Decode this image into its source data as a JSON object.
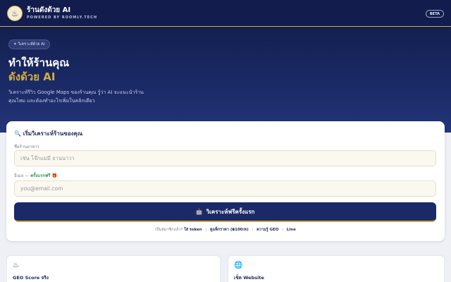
{
  "header": {
    "logo_icon": "chef-pot-icon",
    "title": "ร้านดังด้วย AI",
    "subtitle": "POWERED BY ROOMLY.TECH",
    "badge": "BETA"
  },
  "hero": {
    "badge": "✦ วิเคราะห์ด้วย AI",
    "headline_1": "ทำให้ร้านคุณ",
    "headline_2": "ดังด้วย AI",
    "description": "วิเคราะห์รีวิว Google Maps ของร้านคุณ รู้ว่า AI จะแนะนำร้านคุณไหม และต้องทำอะไรเพิ่มในคลิกเดียว"
  },
  "form": {
    "title": "🔍 เริ่มวิเคราะห์ร้านของคุณ",
    "restaurant_label": "ชื่อร้านอาหาร",
    "restaurant_placeholder": "เช่น โจ๊กแม่มี ยานนาวา",
    "email_label": "อีเมล —",
    "email_promo": "ครั้งแรกฟรี 🎁",
    "email_placeholder": "you@email.com",
    "submit_icon": "robot-icon",
    "submit_label": "วิเคราะห์ฟรีครั้งแรก"
  },
  "footer": {
    "prefix": "เป็นสมาชิกแล้ว?",
    "links": [
      "ใส่ token",
      "ดูแพ็กราคา (฿100/ด)",
      "ความรู้ GEO",
      "Line"
    ]
  },
  "features": [
    {
      "icon": "chef-pot-icon",
      "title": "GEO Score จริง"
    },
    {
      "icon": "globe-icon",
      "title": "เช็ค Website"
    }
  ],
  "colors": {
    "navy": "#121d4e",
    "gold": "#c9a94a",
    "green": "#2e9a4d"
  }
}
